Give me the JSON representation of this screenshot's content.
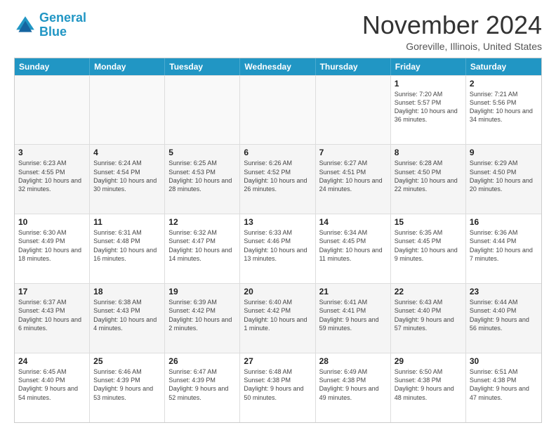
{
  "logo": {
    "line1": "General",
    "line2": "Blue"
  },
  "title": "November 2024",
  "subtitle": "Goreville, Illinois, United States",
  "days": [
    "Sunday",
    "Monday",
    "Tuesday",
    "Wednesday",
    "Thursday",
    "Friday",
    "Saturday"
  ],
  "rows": [
    [
      {
        "day": "",
        "info": ""
      },
      {
        "day": "",
        "info": ""
      },
      {
        "day": "",
        "info": ""
      },
      {
        "day": "",
        "info": ""
      },
      {
        "day": "",
        "info": ""
      },
      {
        "day": "1",
        "info": "Sunrise: 7:20 AM\nSunset: 5:57 PM\nDaylight: 10 hours and 36 minutes."
      },
      {
        "day": "2",
        "info": "Sunrise: 7:21 AM\nSunset: 5:56 PM\nDaylight: 10 hours and 34 minutes."
      }
    ],
    [
      {
        "day": "3",
        "info": "Sunrise: 6:23 AM\nSunset: 4:55 PM\nDaylight: 10 hours and 32 minutes."
      },
      {
        "day": "4",
        "info": "Sunrise: 6:24 AM\nSunset: 4:54 PM\nDaylight: 10 hours and 30 minutes."
      },
      {
        "day": "5",
        "info": "Sunrise: 6:25 AM\nSunset: 4:53 PM\nDaylight: 10 hours and 28 minutes."
      },
      {
        "day": "6",
        "info": "Sunrise: 6:26 AM\nSunset: 4:52 PM\nDaylight: 10 hours and 26 minutes."
      },
      {
        "day": "7",
        "info": "Sunrise: 6:27 AM\nSunset: 4:51 PM\nDaylight: 10 hours and 24 minutes."
      },
      {
        "day": "8",
        "info": "Sunrise: 6:28 AM\nSunset: 4:50 PM\nDaylight: 10 hours and 22 minutes."
      },
      {
        "day": "9",
        "info": "Sunrise: 6:29 AM\nSunset: 4:50 PM\nDaylight: 10 hours and 20 minutes."
      }
    ],
    [
      {
        "day": "10",
        "info": "Sunrise: 6:30 AM\nSunset: 4:49 PM\nDaylight: 10 hours and 18 minutes."
      },
      {
        "day": "11",
        "info": "Sunrise: 6:31 AM\nSunset: 4:48 PM\nDaylight: 10 hours and 16 minutes."
      },
      {
        "day": "12",
        "info": "Sunrise: 6:32 AM\nSunset: 4:47 PM\nDaylight: 10 hours and 14 minutes."
      },
      {
        "day": "13",
        "info": "Sunrise: 6:33 AM\nSunset: 4:46 PM\nDaylight: 10 hours and 13 minutes."
      },
      {
        "day": "14",
        "info": "Sunrise: 6:34 AM\nSunset: 4:45 PM\nDaylight: 10 hours and 11 minutes."
      },
      {
        "day": "15",
        "info": "Sunrise: 6:35 AM\nSunset: 4:45 PM\nDaylight: 10 hours and 9 minutes."
      },
      {
        "day": "16",
        "info": "Sunrise: 6:36 AM\nSunset: 4:44 PM\nDaylight: 10 hours and 7 minutes."
      }
    ],
    [
      {
        "day": "17",
        "info": "Sunrise: 6:37 AM\nSunset: 4:43 PM\nDaylight: 10 hours and 6 minutes."
      },
      {
        "day": "18",
        "info": "Sunrise: 6:38 AM\nSunset: 4:43 PM\nDaylight: 10 hours and 4 minutes."
      },
      {
        "day": "19",
        "info": "Sunrise: 6:39 AM\nSunset: 4:42 PM\nDaylight: 10 hours and 2 minutes."
      },
      {
        "day": "20",
        "info": "Sunrise: 6:40 AM\nSunset: 4:42 PM\nDaylight: 10 hours and 1 minute."
      },
      {
        "day": "21",
        "info": "Sunrise: 6:41 AM\nSunset: 4:41 PM\nDaylight: 9 hours and 59 minutes."
      },
      {
        "day": "22",
        "info": "Sunrise: 6:43 AM\nSunset: 4:40 PM\nDaylight: 9 hours and 57 minutes."
      },
      {
        "day": "23",
        "info": "Sunrise: 6:44 AM\nSunset: 4:40 PM\nDaylight: 9 hours and 56 minutes."
      }
    ],
    [
      {
        "day": "24",
        "info": "Sunrise: 6:45 AM\nSunset: 4:40 PM\nDaylight: 9 hours and 54 minutes."
      },
      {
        "day": "25",
        "info": "Sunrise: 6:46 AM\nSunset: 4:39 PM\nDaylight: 9 hours and 53 minutes."
      },
      {
        "day": "26",
        "info": "Sunrise: 6:47 AM\nSunset: 4:39 PM\nDaylight: 9 hours and 52 minutes."
      },
      {
        "day": "27",
        "info": "Sunrise: 6:48 AM\nSunset: 4:38 PM\nDaylight: 9 hours and 50 minutes."
      },
      {
        "day": "28",
        "info": "Sunrise: 6:49 AM\nSunset: 4:38 PM\nDaylight: 9 hours and 49 minutes."
      },
      {
        "day": "29",
        "info": "Sunrise: 6:50 AM\nSunset: 4:38 PM\nDaylight: 9 hours and 48 minutes."
      },
      {
        "day": "30",
        "info": "Sunrise: 6:51 AM\nSunset: 4:38 PM\nDaylight: 9 hours and 47 minutes."
      }
    ]
  ]
}
